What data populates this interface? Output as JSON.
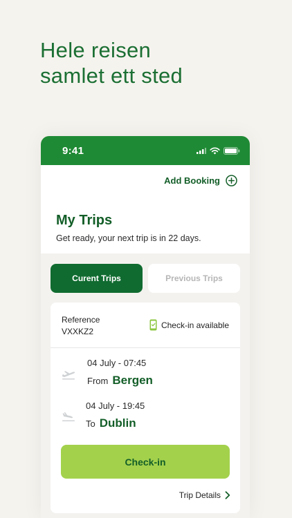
{
  "headline": {
    "line1": "Hele reisen",
    "line2": "samlet ett sted"
  },
  "status_bar": {
    "time": "9:41"
  },
  "header": {
    "add_booking_label": "Add Booking"
  },
  "page": {
    "title": "My Trips",
    "subtitle": "Get ready, your next trip is in 22 days."
  },
  "tabs": [
    {
      "label": "Curent Trips",
      "active": true
    },
    {
      "label": "Previous Trips",
      "active": false
    }
  ],
  "trip": {
    "reference_label": "Reference",
    "reference_value": "VXXKZ2",
    "checkin_status": "Check-in available",
    "departure": {
      "datetime": "04 July - 07:45",
      "prefix": "From",
      "city": "Bergen"
    },
    "arrival": {
      "datetime": "04 July - 19:45",
      "prefix": "To",
      "city": "Dublin"
    },
    "checkin_button_label": "Check-in",
    "details_link_label": "Trip Details"
  },
  "colors": {
    "brand_green": "#1f8a35",
    "dark_green": "#135e28",
    "button_lime": "#a3d14c",
    "background": "#f5f3ee"
  },
  "icons": [
    "signal-icon",
    "wifi-icon",
    "battery-icon",
    "plus-circle-icon",
    "phone-check-icon",
    "takeoff-icon",
    "landing-icon",
    "chevron-right-icon"
  ]
}
